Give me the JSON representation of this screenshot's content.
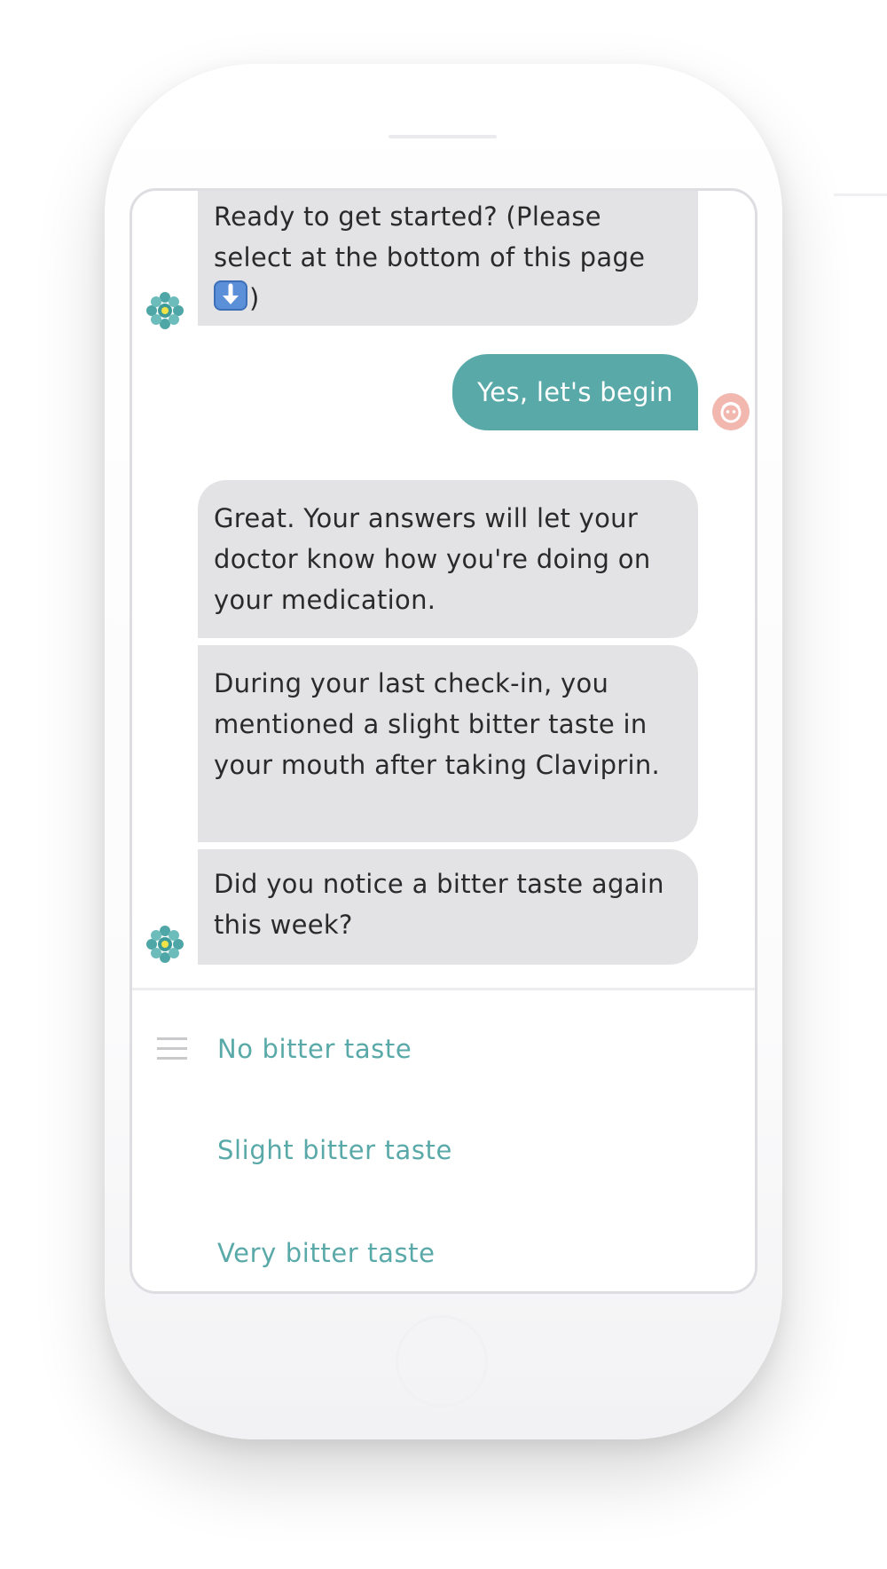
{
  "chat": {
    "messages": [
      {
        "sender": "bot",
        "text_before": "Ready to get started? (Please select at the bottom of this page ",
        "emoji": "down-arrow-emoji",
        "text_after": ")"
      },
      {
        "sender": "user",
        "text": "Yes, let's begin"
      },
      {
        "sender": "bot",
        "text": "Great. Your answers will let your doctor know how you're doing on your medication."
      },
      {
        "sender": "bot",
        "text": "During your last check-in, you mentioned a slight bitter taste in your mouth after taking Claviprin."
      },
      {
        "sender": "bot",
        "text": "Did you notice a bitter taste again this week?"
      }
    ]
  },
  "options": [
    {
      "label": "No bitter taste"
    },
    {
      "label": "Slight bitter taste"
    },
    {
      "label": "Very bitter taste"
    }
  ],
  "icons": {
    "bot_avatar": "bot-avatar-icon",
    "user_avatar": "user-avatar-icon",
    "menu": "menu-icon"
  },
  "colors": {
    "accent": "#5aa9a9",
    "bot_bubble": "#e3e3e5",
    "user_avatar": "#f2b8b0",
    "text": "#2a2a2a"
  }
}
